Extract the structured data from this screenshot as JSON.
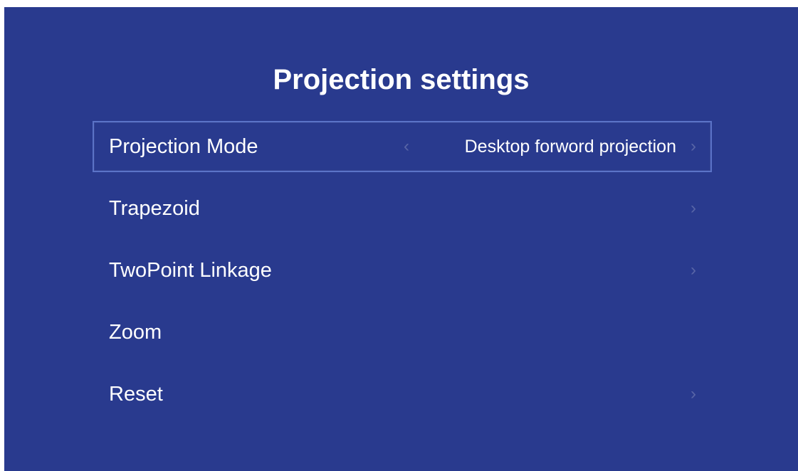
{
  "page": {
    "title": "Projection settings",
    "background_color": "#293a8e",
    "focus_border_color": "#5b73c7"
  },
  "menu": {
    "items": [
      {
        "label": "Projection Mode",
        "value": "Desktop forword projection",
        "focused": true,
        "left_arrow": "‹",
        "right_arrow": "›"
      },
      {
        "label": "Trapezoid",
        "right_arrow": "›"
      },
      {
        "label": "TwoPoint Linkage",
        "right_arrow": "›"
      },
      {
        "label": "Zoom"
      },
      {
        "label": "Reset",
        "right_arrow": "›"
      }
    ]
  },
  "icons": {
    "left": "chevron-left-icon",
    "right": "chevron-right-icon"
  }
}
